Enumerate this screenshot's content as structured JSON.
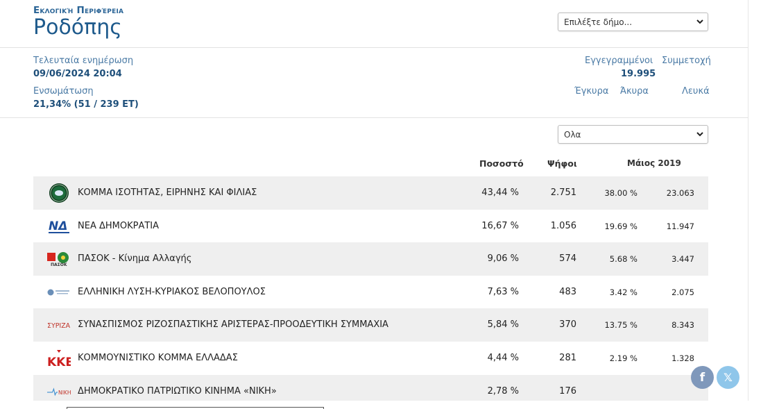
{
  "header": {
    "region_label": "Εκλογική Περιφέρεια",
    "region_name": "Ροδόπης",
    "dimos_select": "Επιλέξτε δήμο..."
  },
  "stats": {
    "last_update_label": "Τελευταία ενημέρωση",
    "last_update_value": "09/06/2024 20:04",
    "incorporation_label": "Ενσωμάτωση",
    "incorporation_value": "21,34% (51 / 239 ΕΤ)",
    "registered_label": "Εγγεγραμμένοι",
    "registered_value": "19.995",
    "participation_label": "Συμμετοχή",
    "valid_label": "Έγκυρα",
    "invalid_label": "Άκυρα",
    "blank_label": "Λευκά"
  },
  "filter": {
    "select": "Ολα"
  },
  "table": {
    "headers": {
      "percent": "Ποσοστό",
      "votes": "Ψήφοι",
      "prev": "Μάιος 2019"
    },
    "rows": [
      {
        "name": "ΚΟΜΜΑ ΙΣΟΤΗΤΑΣ, ΕΙΡΗΝΗΣ ΚΑΙ ΦΙΛΙΑΣ",
        "pct": "43,44 %",
        "votes": "2.751",
        "pct19": "38.00 %",
        "votes19": "23.063",
        "logo": "keif-logo"
      },
      {
        "name": "ΝΕΑ ΔΗΜΟΚΡΑΤΙΑ",
        "pct": "16,67 %",
        "votes": "1.056",
        "pct19": "19.69 %",
        "votes19": "11.947",
        "logo": "nd-logo",
        "logo_text": "ΝΔ"
      },
      {
        "name": "ΠΑΣΟΚ - Κίνημα Αλλαγής",
        "pct": "9,06 %",
        "votes": "574",
        "pct19": "5.68 %",
        "votes19": "3.447",
        "logo": "pasok-logo",
        "logo_text": "ΠΑΣΟΚ"
      },
      {
        "name": "ΕΛΛΗΝΙΚΗ ΛΥΣΗ-ΚΥΡΙΑΚΟΣ ΒΕΛΟΠΟΥΛΟΣ",
        "pct": "7,63 %",
        "votes": "483",
        "pct19": "3.42 %",
        "votes19": "2.075",
        "logo": "elliniki-lysi-logo"
      },
      {
        "name": "ΣΥΝΑΣΠΙΣΜΟΣ ΡΙΖΟΣΠΑΣΤΙΚΗΣ ΑΡΙΣΤΕΡΑΣ-ΠΡΟΟΔΕΥΤΙΚΗ ΣΥΜΜΑΧΙΑ",
        "pct": "5,84 %",
        "votes": "370",
        "pct19": "13.75 %",
        "votes19": "8.343",
        "logo": "syriza-logo",
        "logo_text": "ΣΥΡΙΖΑ"
      },
      {
        "name": "ΚΟΜΜΟΥΝΙΣΤΙΚΟ ΚΟΜΜΑ ΕΛΛΑΔΑΣ",
        "pct": "4,44 %",
        "votes": "281",
        "pct19": "2.19 %",
        "votes19": "1.328",
        "logo": "kke-logo",
        "logo_text": "ΚΚΕ"
      },
      {
        "name": "ΔΗΜΟΚΡΑΤΙΚΟ ΠΑΤΡΙΩΤΙΚΟ ΚΙΝΗΜΑ «ΝΙΚΗ»",
        "pct": "2,78 %",
        "votes": "176",
        "pct19": "",
        "votes19": "",
        "logo": "niki-logo",
        "logo_text": "ΝΙΚΗ"
      }
    ]
  },
  "social": {
    "facebook": "f",
    "x": "𝕏"
  },
  "colors": {
    "accent": "#1e5a8c",
    "link": "#4a7aa5",
    "row_alt": "#efefef"
  }
}
